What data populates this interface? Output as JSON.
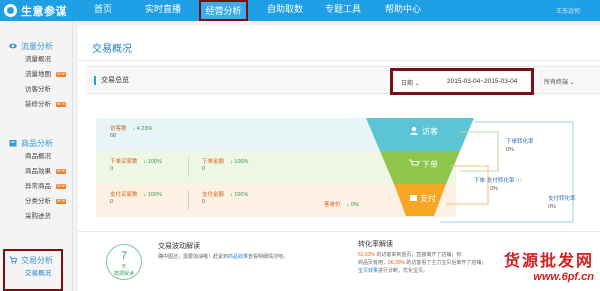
{
  "brand": {
    "name": "生意参谋"
  },
  "nav": {
    "items": [
      {
        "label": "首页"
      },
      {
        "label": "实时直播"
      },
      {
        "label": "经营分析"
      },
      {
        "label": "自助取数"
      },
      {
        "label": "专题工具"
      },
      {
        "label": "帮助中心"
      }
    ],
    "user": "王东远何"
  },
  "sidebar": {
    "groups": [
      {
        "title": "流量分析",
        "items": [
          "流量概况",
          "流量地图",
          "访客分析",
          "装修分析"
        ]
      },
      {
        "title": "商品分析",
        "items": [
          "商品概况",
          "商品效果",
          "异常商品",
          "分类分析",
          "采购进货"
        ]
      },
      {
        "title": "交易分析",
        "items": [
          "交易概况"
        ]
      }
    ],
    "badge": "NEW"
  },
  "main": {
    "page_title": "交易概况",
    "section_title": "交易总览",
    "date_label": "日期 ⌄",
    "date_range": "2015-03-04~2015-03-04",
    "terminal_label": "所有终端 ⌄"
  },
  "funnel": {
    "visitors": {
      "label": "访客数",
      "change": "↓ 4.23%",
      "value": "68"
    },
    "order_buyers": {
      "label": "下单买家数",
      "change": "↓ 100%",
      "value": "0"
    },
    "order_amount": {
      "label": "下单金额",
      "change": "↓ 100%",
      "value": "0"
    },
    "pay_buyers": {
      "label": "支付买家数",
      "change": "↓ 100%",
      "value": "0"
    },
    "pay_amount": {
      "label": "支付金额",
      "change": "↓ 100%",
      "value": "0"
    },
    "unit_price": {
      "label": "客单价",
      "change": "↓ 0%"
    },
    "stages": [
      "访客",
      "下单",
      "支付"
    ],
    "conversions": [
      {
        "label": "下单转化率",
        "value": "0%"
      },
      {
        "label": "下单-支付转化率 ⓘ",
        "value": "0%"
      },
      {
        "label": "支付转化率",
        "value": "0%"
      }
    ],
    "colors": {
      "teal": "#5bc5d6",
      "green": "#8dc64b",
      "orange": "#f6a623"
    }
  },
  "bottom": {
    "circle": {
      "num": "7",
      "unit": "天",
      "caption": "数据解读"
    },
    "left_title": "交易波动解读",
    "left_text_a": "确中图还，需要加油哦！赶紧到",
    "left_text_link": "商品效果",
    "left_text_b": "查看明细情况吧。",
    "right_title": "转化率解读",
    "right_line1_a": "52.63%",
    "right_line1_b": " 的访客来到首页，直接离开了店铺；有",
    "right_line2_a": "商品页有用，",
    "right_line2_b": "96.30%",
    "right_line2_c": " 的访客看了主力宝贝后离开了店铺；",
    "right_line3": "宝贝效果",
    "right_line3_b": "进行诊断，优化宝贝。"
  },
  "watermark": {
    "line1": "货源批发网",
    "line2": "www.6pf.cn"
  }
}
